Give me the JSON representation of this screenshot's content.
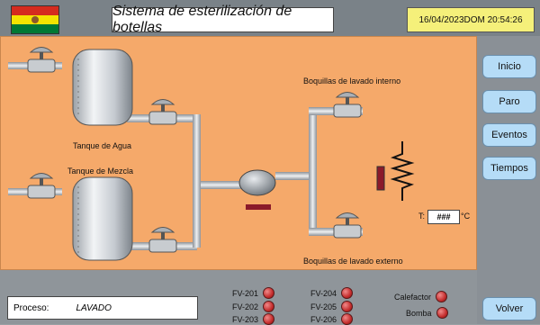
{
  "header": {
    "title": "Sistema de esterilización de botellas",
    "datetime": "16/04/2023DOM 20:54:26",
    "flag_colors": [
      "#d52b1e",
      "#f4e400",
      "#007934"
    ]
  },
  "process": {
    "tank_water_label": "Tanque de Agua",
    "tank_mix_label": "Tanque de Mezcla",
    "nozzle_internal_label": "Boquillas de lavado interno",
    "nozzle_external_label": "Boquillas de lavado externo",
    "temp_prefix": "T:",
    "temp_value": "###",
    "temp_unit": "°C",
    "background_color": "#f5a96a"
  },
  "sidebar": {
    "buttons": [
      {
        "label": "Inicio"
      },
      {
        "label": "Paro"
      },
      {
        "label": "Eventos"
      },
      {
        "label": "Tiempos"
      }
    ],
    "back_label": "Volver"
  },
  "footer": {
    "process_label": "Proceso:",
    "process_value": "LAVADO",
    "valves_col1": [
      "FV-201",
      "FV-202",
      "FV-203"
    ],
    "valves_col2": [
      "FV-204",
      "FV-205",
      "FV-206"
    ],
    "heater_label": "Calefactor",
    "pump_label": "Bomba",
    "led_color": "#c42d2d"
  }
}
